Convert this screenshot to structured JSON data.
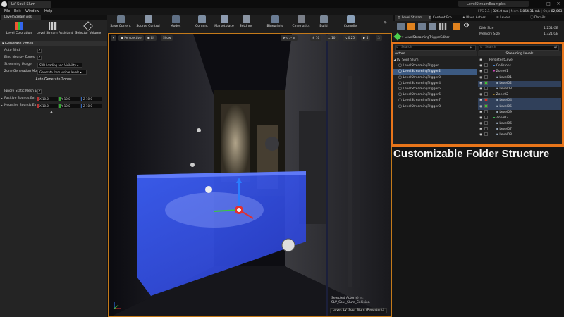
{
  "titlebar": {
    "doc_tab": "LV_Soul_Slum",
    "project": "LevelStreamExamples",
    "minimize": "–",
    "maximize": "□",
    "close": "✕"
  },
  "menu": [
    "File",
    "Edit",
    "Window",
    "Help"
  ],
  "stats": {
    "fps_label": "FPS",
    "fps": "3.1",
    "ms": "326.0 ms",
    "mem_label": "Mem",
    "mem": "5,854.31 mb",
    "objs_label": "Objs",
    "objs": "82,063"
  },
  "left_panel": {
    "tab": "Level Stream Assi",
    "tools": [
      {
        "label": "Level Coloration",
        "icon": "color-palette-icon"
      },
      {
        "label": "Level Stream Assistant",
        "icon": "grid-icon"
      },
      {
        "label": "Selector Volume",
        "icon": "cube-icon"
      }
    ],
    "section": "Generate Zones",
    "auto_bind": "Auto Bind",
    "bind_nearby": "Bind Nearby Zones",
    "streaming_usage_label": "Streaming Usage",
    "streaming_usage_value": "SVB Loading and Visibility",
    "zone_generation_label": "Zone Generation Mo",
    "zone_generation_value": "Generate from visible levels",
    "generate_button": "Auto Generate Zones",
    "ignore_static": "Ignore Static Mesh E",
    "positive_bounds": "Positive Bounds Ext",
    "negative_bounds": "Negative Bounds Ex",
    "positive_values": [
      "X  10.0",
      "Y  10.0",
      "Z  10.0"
    ],
    "negative_values": [
      "X  10.0",
      "Y  10.0",
      "Z  10.0"
    ],
    "collapse": "▲"
  },
  "toolbar": {
    "buttons": [
      {
        "label": "Save Current",
        "icon": "save-icon",
        "color": "#6b7a8c"
      },
      {
        "label": "Source Control",
        "icon": "source-control-icon",
        "color": "#8a97a8"
      },
      {
        "label": "Modes",
        "icon": "modes-icon",
        "color": "#5f6f84"
      },
      {
        "label": "Content",
        "icon": "content-icon",
        "color": "#7d8ea3"
      },
      {
        "label": "Marketplace",
        "icon": "marketplace-icon",
        "color": "#8d9bb0"
      },
      {
        "label": "Settings",
        "icon": "settings-icon",
        "color": "#8b95a3"
      },
      {
        "label": "Blueprints",
        "icon": "blueprints-icon",
        "color": "#6a7c94"
      },
      {
        "label": "Cinematics",
        "icon": "cinematics-icon",
        "color": "#7a7f88"
      },
      {
        "label": "Build",
        "icon": "build-icon",
        "color": "#7b8898"
      },
      {
        "label": "Compile",
        "icon": "compile-icon",
        "color": "#8aa0b9"
      }
    ],
    "more": "»"
  },
  "viewport": {
    "perspective": "Perspective",
    "lit": "Lit",
    "show": "Show",
    "snap_grid": "10",
    "snap_angle": "10°",
    "snap_scale": "0.25",
    "cam_speed": "4",
    "selected_line1": "Selected Actor(s) in:",
    "selected_line2": "SLV_Soul_Slum_Collision",
    "level_label": "Level:  LV_Soul_Slum (Persistent)"
  },
  "right_tabs": [
    "Level Stream",
    "Content Bro",
    "Place Actors",
    "Levels",
    "Details"
  ],
  "level_editor": {
    "label": "LevelStreamingTriggerEditor",
    "disk_size_label": "Disk Size",
    "disk_size": "1.251 GB",
    "memory_size_label": "Memory Size",
    "memory_size": "1.321 GB"
  },
  "actors": {
    "search_placeholder": "Search",
    "header": "Actors",
    "root": "LV_Soul_Slum",
    "items": [
      "LevelStreamingTrigger",
      "LevelStreamingTrigger2",
      "LevelStreamingTrigger3",
      "LevelStreamingTrigger4",
      "LevelStreamingTrigger5",
      "LevelStreamingTrigger6",
      "LevelStreamingTrigger7",
      "LevelStreamingTrigger8"
    ]
  },
  "streaming_levels": {
    "search_placeholder": "Search",
    "header": "Streaming Levels",
    "items": [
      {
        "label": "PersistentLevel",
        "indent": 0,
        "swatch": "",
        "folder": ""
      },
      {
        "label": "Collisions",
        "indent": 1,
        "swatch": "",
        "folder": "#4a82c8"
      },
      {
        "label": "Zone01",
        "indent": 1,
        "swatch": "",
        "folder": "#c94ab8"
      },
      {
        "label": "Level01",
        "indent": 2,
        "swatch": "",
        "folder": ""
      },
      {
        "label": "Level02",
        "indent": 2,
        "swatch": "#38c838",
        "folder": ""
      },
      {
        "label": "Level03",
        "indent": 2,
        "swatch": "",
        "folder": ""
      },
      {
        "label": "Zone02",
        "indent": 1,
        "swatch": "",
        "folder": "#d8a830"
      },
      {
        "label": "Level04",
        "indent": 2,
        "swatch": "#e02828",
        "folder": ""
      },
      {
        "label": "Level05",
        "indent": 2,
        "swatch": "#38c838",
        "folder": ""
      },
      {
        "label": "Level09",
        "indent": 2,
        "swatch": "",
        "folder": ""
      },
      {
        "label": "Zone03",
        "indent": 1,
        "swatch": "",
        "folder": "#38b850"
      },
      {
        "label": "Level06",
        "indent": 2,
        "swatch": "",
        "folder": ""
      },
      {
        "label": "Level07",
        "indent": 2,
        "swatch": "",
        "folder": ""
      },
      {
        "label": "Level08",
        "indent": 2,
        "swatch": "",
        "folder": ""
      }
    ]
  },
  "caption": "Customizable Folder Structure",
  "colors": {
    "accent": "#e8751a",
    "selection": "#3c5a82",
    "volume": "#3a5aff"
  }
}
